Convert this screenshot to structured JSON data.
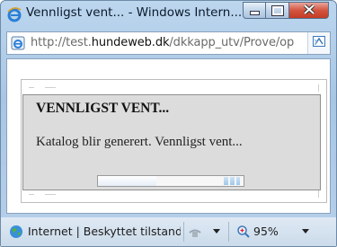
{
  "window": {
    "title": "Vennligst vent... - Windows Intern...",
    "buttons": [
      "minimize",
      "maximize",
      "close"
    ]
  },
  "address_bar": {
    "url_prefix": "http://test.",
    "url_domain": "hundeweb.dk",
    "url_path": "/dkkapp_utv/Prove/op"
  },
  "dialog": {
    "heading": "VENNLIGST VENT...",
    "message": "Katalog blir generert. Vennligst vent...",
    "progress_percent": 40
  },
  "status_bar": {
    "zone": "Internet | Beskyttet tilstand",
    "zoom": "95%"
  },
  "icons": {
    "app": "ie-logo-icon",
    "page": "ie-page-icon",
    "compat": "compatibility-view-icon",
    "zone": "globe-icon",
    "protected": "protected-mode-icon",
    "zoom": "zoom-icon"
  },
  "colors": {
    "frame": "#a8c6e4",
    "dialog_bg": "#dcdcdc",
    "close_button": "#d3553f"
  }
}
